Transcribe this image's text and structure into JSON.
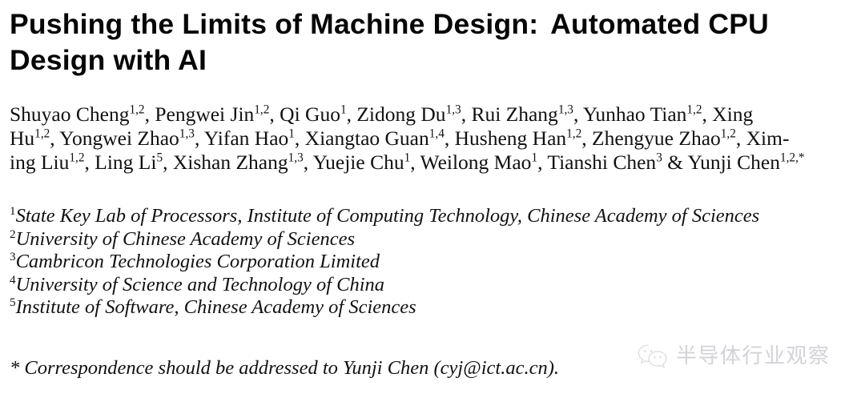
{
  "document": {
    "type": "paper-header",
    "background_color": "#ffffff",
    "text_color": "#000000"
  },
  "title": {
    "line1_a": "Pushing the Limits of Machine Design:",
    "line1_b": "Automated CPU",
    "line2": "Design with AI",
    "full": "Pushing the Limits of Machine Design: Automated CPU Design with AI"
  },
  "authors": {
    "line1": [
      {
        "name": "Shuyao Cheng",
        "sup": "1,2",
        "sep": ", "
      },
      {
        "name": "Pengwei Jin",
        "sup": "1,2",
        "sep": ", "
      },
      {
        "name": "Qi Guo",
        "sup": "1",
        "sep": ", "
      },
      {
        "name": "Zidong Du",
        "sup": "1,3",
        "sep": ", "
      },
      {
        "name": "Rui Zhang",
        "sup": "1,3",
        "sep": ", "
      },
      {
        "name": "Yunhao Tian",
        "sup": "1,2",
        "sep": ", "
      },
      {
        "name": "Xing",
        "sup": "",
        "sep": ""
      }
    ],
    "line2": [
      {
        "name": "Hu",
        "sup": "1,2",
        "sep": ", "
      },
      {
        "name": "Yongwei Zhao",
        "sup": "1,3",
        "sep": ", "
      },
      {
        "name": "Yifan Hao",
        "sup": "1",
        "sep": ", "
      },
      {
        "name": "Xiangtao Guan",
        "sup": "1,4",
        "sep": ", "
      },
      {
        "name": "Husheng Han",
        "sup": "1,2",
        "sep": ", "
      },
      {
        "name": "Zhengyue Zhao",
        "sup": "1,2",
        "sep": ", "
      },
      {
        "name": "Xim-",
        "sup": "",
        "sep": ""
      }
    ],
    "line3": [
      {
        "name": "ing Liu",
        "sup": "1,2",
        "sep": ", "
      },
      {
        "name": "Ling Li",
        "sup": "5",
        "sep": ", "
      },
      {
        "name": "Xishan Zhang",
        "sup": "1,3",
        "sep": ", "
      },
      {
        "name": "Yuejie Chu",
        "sup": "1",
        "sep": ", "
      },
      {
        "name": "Weilong Mao",
        "sup": "1",
        "sep": ", "
      },
      {
        "name": "Tianshi Chen",
        "sup": "3",
        "sep": " & "
      },
      {
        "name": "Yunji Chen",
        "sup": "1,2,*",
        "sep": ""
      }
    ]
  },
  "affiliations": [
    {
      "marker": "1",
      "text": "State Key Lab of Processors, Institute of Computing Technology, Chinese Academy of Sciences"
    },
    {
      "marker": "2",
      "text": "University of Chinese Academy of Sciences"
    },
    {
      "marker": "3",
      "text": "Cambricon Technologies Corporation Limited"
    },
    {
      "marker": "4",
      "text": "University of Science and Technology of China"
    },
    {
      "marker": "5",
      "text": "Institute of Software, Chinese Academy of Sciences"
    }
  ],
  "correspondence": {
    "text": "* Correspondence should be addressed to Yunji Chen (cyj@ict.ac.cn)."
  },
  "watermark": {
    "logo_name": "wechat-logo",
    "text": "半导体行业观察",
    "color": "#d2d2d6"
  }
}
